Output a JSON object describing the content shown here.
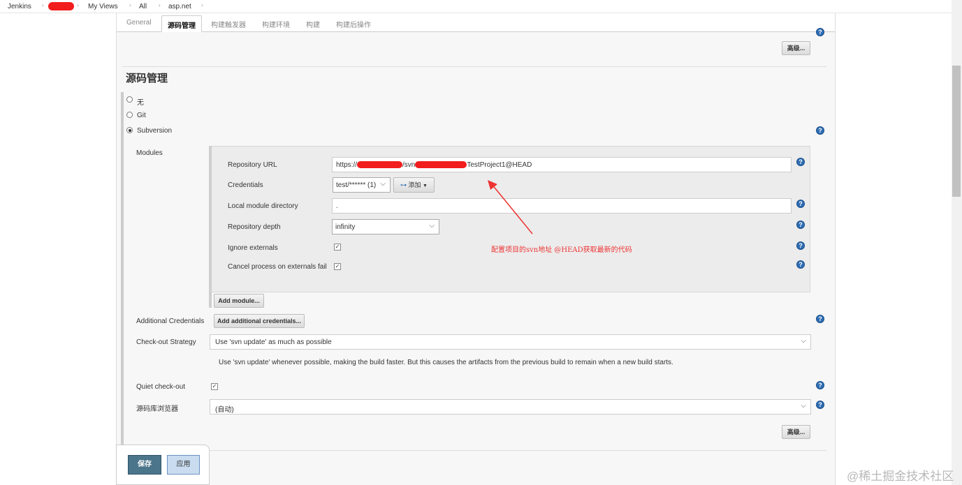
{
  "breadcrumb": {
    "items": [
      "Jenkins",
      "My Views",
      "All",
      "asp.net"
    ],
    "separator": "›"
  },
  "tabs": [
    "General",
    "源码管理",
    "构建触发器",
    "构建环境",
    "构建",
    "构建后操作"
  ],
  "active_tab": "源码管理",
  "advanced_label": "高级...",
  "section": {
    "title": "源码管理",
    "options": [
      "无",
      "Git",
      "Subversion"
    ],
    "selected": "Subversion"
  },
  "modules": {
    "label": "Modules",
    "repository_url_label": "Repository URL",
    "repository_url_value_prefix": "https://",
    "repository_url_value_mid": "/svn",
    "repository_url_value_suffix": "TestProject1@HEAD",
    "credentials_label": "Credentials",
    "credentials_value": "test/****** (1)",
    "add_button_label": "添加",
    "local_module_label": "Local module directory",
    "local_module_value": ".",
    "depth_label": "Repository depth",
    "depth_value": "infinity",
    "ignore_externals_label": "Ignore externals",
    "cancel_externals_label": "Cancel process on externals fail",
    "add_module_label": "Add module..."
  },
  "annotation": "配置项目的svn地址  @HEAD获取最新的代码",
  "additional_credentials": {
    "label": "Additional Credentials",
    "button": "Add additional credentials..."
  },
  "checkout": {
    "label": "Check-out Strategy",
    "value": "Use 'svn update' as much as possible",
    "description": "Use 'svn update' whenever possible, making the build faster. But this causes the artifacts from the previous build to remain when a new build starts."
  },
  "quiet_checkout_label": "Quiet check-out",
  "repo_browser": {
    "label": "源码库浏览器",
    "value": "(自动)"
  },
  "footer": {
    "save": "保存",
    "apply": "应用"
  },
  "watermark": "@稀土掘金技术社区",
  "colors": {
    "save_button": "#4b758b",
    "apply_button": "#c9dcf0",
    "help_icon": "#2e6db3",
    "annotation": "#ee3333"
  }
}
